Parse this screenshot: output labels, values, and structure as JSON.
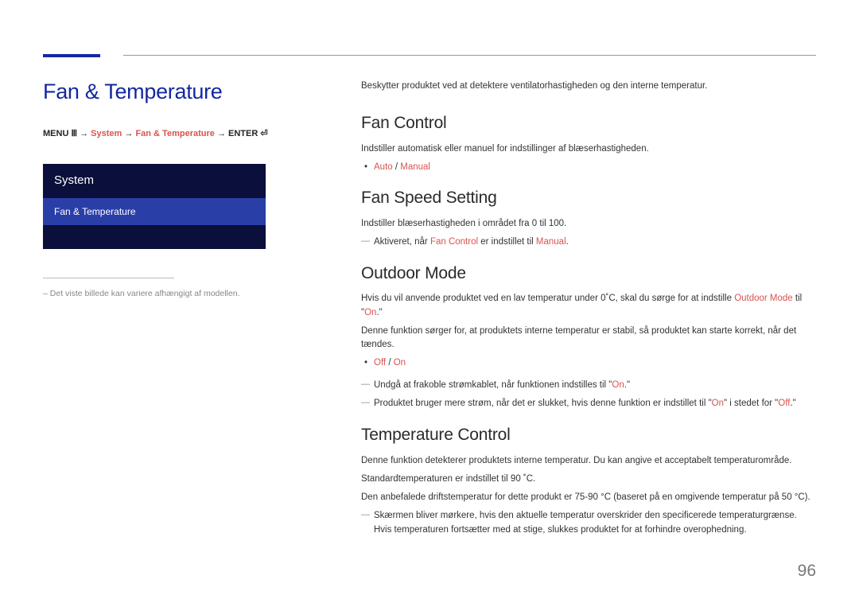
{
  "page_number": "96",
  "left": {
    "title": "Fan & Temperature",
    "breadcrumb": {
      "menu": "MENU",
      "arrow": "→",
      "system": "System",
      "fan_temp": "Fan & Temperature",
      "enter": "ENTER",
      "menu_icon": "Ⅲ",
      "enter_icon": "⏎"
    },
    "menu": {
      "header": "System",
      "item": "Fan & Temperature"
    },
    "note_prefix": "– ",
    "note": "Det viste billede kan variere afhængigt af modellen."
  },
  "right": {
    "intro": "Beskytter produktet ved at detektere ventilatorhastigheden og den interne temperatur.",
    "fan_control": {
      "title": "Fan Control",
      "desc": "Indstiller automatisk eller manuel for indstillinger af blæserhastigheden.",
      "opt1": "Auto",
      "sep": " / ",
      "opt2": "Manual"
    },
    "fan_speed": {
      "title": "Fan Speed Setting",
      "desc": "Indstiller blæserhastigheden i området fra 0 til 100.",
      "note_pre": "Aktiveret, når ",
      "note_em1": "Fan Control",
      "note_mid": " er indstillet til ",
      "note_em2": "Manual",
      "note_end": "."
    },
    "outdoor": {
      "title": "Outdoor Mode",
      "p1_pre": "Hvis du vil anvende produktet ved en lav temperatur under 0˚C, skal du sørge for at indstille ",
      "p1_em": "Outdoor Mode",
      "p1_mid": " til \"",
      "p1_on": "On",
      "p1_end": ".\"",
      "p2": "Denne funktion sørger for, at produktets interne temperatur er stabil, så produktet kan starte korrekt, når det tændes.",
      "opt1": "Off",
      "sep": " / ",
      "opt2": "On",
      "n1_pre": "Undgå at frakoble strømkablet, når funktionen indstilles til \"",
      "n1_on": "On",
      "n1_end": ".\"",
      "n2_pre": "Produktet bruger mere strøm, når det er slukket, hvis denne funktion er indstillet til \"",
      "n2_on": "On",
      "n2_mid": "\" i stedet for \"",
      "n2_off": "Off",
      "n2_end": ".\""
    },
    "temp": {
      "title": "Temperature Control",
      "p1": "Denne funktion detekterer produktets interne temperatur. Du kan angive et acceptabelt temperaturområde.",
      "p2": "Standardtemperaturen er indstillet til 90 ˚C.",
      "p3": "Den anbefalede driftstemperatur for dette produkt er 75-90 °C (baseret på en omgivende temperatur på 50 °C).",
      "n1": "Skærmen bliver mørkere, hvis den aktuelle temperatur overskrider den specificerede temperaturgrænse. Hvis temperaturen fortsætter med at stige, slukkes produktet for at forhindre overophedning."
    }
  }
}
